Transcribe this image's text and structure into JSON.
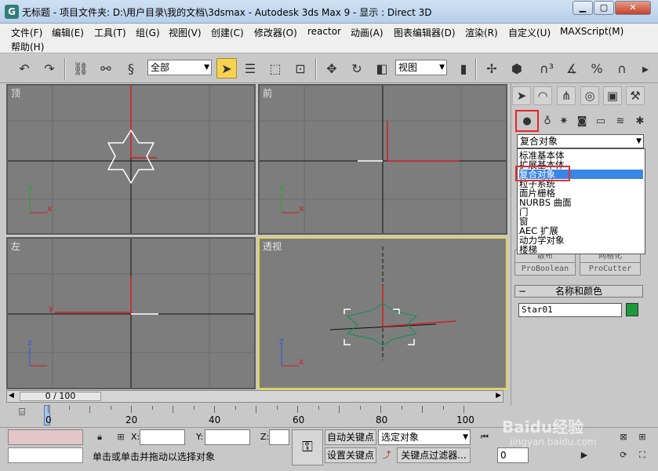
{
  "window": {
    "title": "无标题   - 项目文件夹: D:\\用户目录\\我的文档\\3dsmax   - Autodesk 3ds Max 9   - 显示 : Direct 3D",
    "app_icon": "G",
    "minimize": "▁",
    "maximize": "▢",
    "close": "✕"
  },
  "menu": {
    "items": [
      "文件(F)",
      "编辑(E)",
      "工具(T)",
      "组(G)",
      "视图(V)",
      "创建(C)",
      "修改器(O)",
      "reactor",
      "动画(A)",
      "图表编辑器(D)",
      "渲染(R)",
      "自定义(U)",
      "MAXScript(M)",
      "帮助(H)"
    ]
  },
  "toolbar": {
    "selection_filter": "全部",
    "reference_coord": "视图"
  },
  "viewports": {
    "top": "顶",
    "front": "前",
    "left": "左",
    "perspective": "透视"
  },
  "axes": {
    "x": "x",
    "y": "y",
    "z": "z"
  },
  "command_panel": {
    "category_selected": "复合对象",
    "category_options": [
      "标准基本体",
      "扩展基本体",
      "复合对象",
      "粒子系统",
      "面片栅格",
      "NURBS 曲面",
      "门",
      "窗",
      "AEC 扩展",
      "动力学对象",
      "楼梯"
    ],
    "selected_index": 2,
    "object_buttons": [
      "散布",
      "网格化",
      "ProBoolean",
      "ProCutter"
    ],
    "rollout_title": "名称和颜色",
    "object_name": "Star01",
    "object_color": "#1a9a3c"
  },
  "timeline": {
    "position": "0 / 100",
    "ticks": [
      "0",
      "20",
      "40",
      "60",
      "80",
      "100"
    ]
  },
  "status": {
    "x_label": "X:",
    "y_label": "Y:",
    "z_label": "Z:",
    "auto_key": "自动关键点",
    "set_key": "设置关键点",
    "key_mode_select": "选定对象",
    "key_filters": "关键点过滤器...",
    "frame": "0",
    "prompt": "单击或单击并拖动以选择对象"
  },
  "watermark": {
    "brand": "Baidu经验",
    "url": "jingyan.baidu.com"
  }
}
